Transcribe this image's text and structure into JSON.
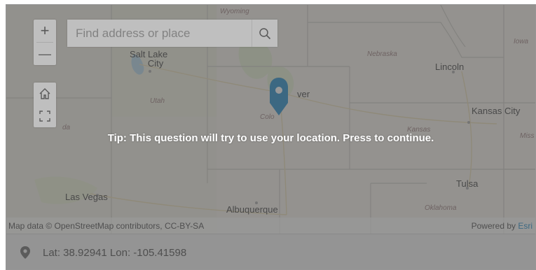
{
  "map": {
    "cities": [
      {
        "id": "salt-lake-city",
        "line1": "Salt Lake",
        "line2": "City"
      },
      {
        "id": "denver",
        "name": "Denver",
        "visible_text": "ver"
      },
      {
        "id": "lincoln",
        "name": "Lincoln"
      },
      {
        "id": "kansas-city",
        "name": "Kansas City"
      },
      {
        "id": "tulsa",
        "name": "Tulsa"
      },
      {
        "id": "las-vegas",
        "name": "Las Vegas"
      },
      {
        "id": "albuquerque",
        "name": "Albuquerque"
      }
    ],
    "states": [
      {
        "id": "wyoming",
        "name": "Wyoming"
      },
      {
        "id": "nebraska",
        "name": "Nebraska"
      },
      {
        "id": "iowa",
        "name": "Iowa"
      },
      {
        "id": "utah",
        "name": "Utah"
      },
      {
        "id": "colorado",
        "name": "Colorado",
        "visible_text": "Colo"
      },
      {
        "id": "kansas",
        "name": "Kansas"
      },
      {
        "id": "missouri",
        "name": "Missouri",
        "visible_text": "Miss"
      },
      {
        "id": "oklahoma",
        "name": "Oklahoma"
      },
      {
        "id": "nevada",
        "name": "Nevada",
        "visible_text": "da"
      }
    ]
  },
  "search": {
    "placeholder": "Find address or place"
  },
  "controls": {
    "zoom_in": "+",
    "zoom_out": "—",
    "home_icon": "home-icon",
    "fullscreen_icon": "fullscreen-icon",
    "search_icon": "search-icon"
  },
  "overlay": {
    "tip": "Tip: This question will try to use your location. Press to continue."
  },
  "attribution": {
    "left": "Map data © OpenStreetMap contributors, CC-BY-SA",
    "powered_by": "Powered by ",
    "brand": "Esri"
  },
  "marker": {
    "icon": "map-pin-icon",
    "color": "#0079c1"
  },
  "location": {
    "icon": "location-pin-icon",
    "text": "Lat: 38.92941  Lon: -105.41598"
  },
  "colors": {
    "accent": "#0079c1",
    "overlay": "#5f5f5f"
  }
}
